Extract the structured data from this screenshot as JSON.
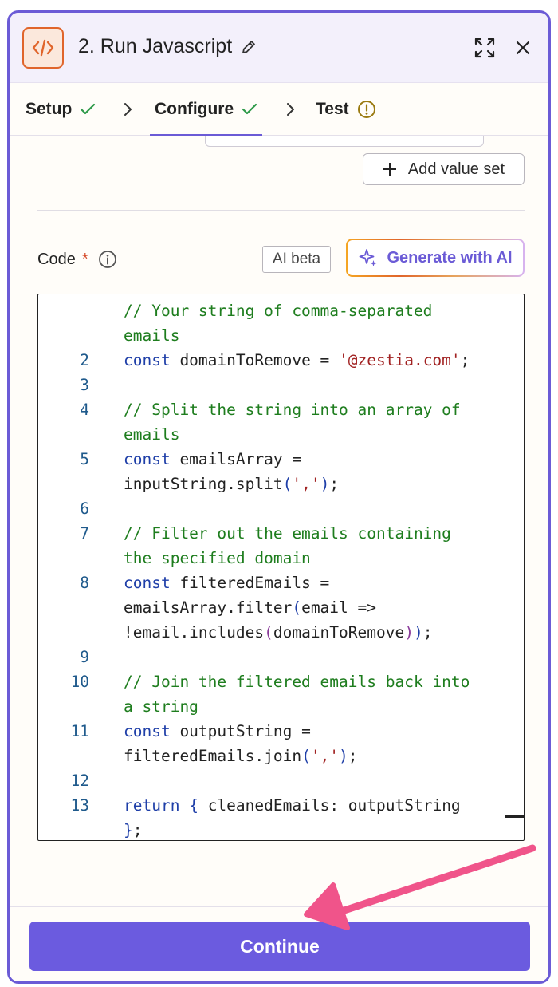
{
  "header": {
    "title": "2. Run Javascript",
    "icon": "code-icon",
    "accent": "#6b5bd6"
  },
  "tabs": [
    {
      "label": "Setup",
      "status": "complete"
    },
    {
      "label": "Configure",
      "status": "complete",
      "active": true
    },
    {
      "label": "Test",
      "status": "warning"
    }
  ],
  "config": {
    "add_value_set_label": "Add value set",
    "code_label": "Code",
    "required_mark": "*",
    "ai_badge": "AI beta",
    "generate_label": "Generate with AI"
  },
  "editor": {
    "lines": [
      {
        "num": "",
        "segments": [
          {
            "t": "// Your string of comma-separated",
            "k": "cm"
          }
        ]
      },
      {
        "num": "",
        "segments": [
          {
            "t": "emails",
            "k": "cm"
          }
        ]
      },
      {
        "num": "2",
        "segments": [
          {
            "t": "const",
            "k": "kw"
          },
          {
            "t": " domainToRemove = ",
            "k": "tx"
          },
          {
            "t": "'@zestia.com'",
            "k": "str"
          },
          {
            "t": ";",
            "k": "tx"
          }
        ]
      },
      {
        "num": "3",
        "segments": []
      },
      {
        "num": "4",
        "segments": [
          {
            "t": "// Split the string into an array of",
            "k": "cm"
          }
        ]
      },
      {
        "num": "",
        "segments": [
          {
            "t": "emails",
            "k": "cm"
          }
        ]
      },
      {
        "num": "5",
        "segments": [
          {
            "t": "const",
            "k": "kw"
          },
          {
            "t": " emailsArray =",
            "k": "tx"
          }
        ]
      },
      {
        "num": "",
        "segments": [
          {
            "t": "inputString.split",
            "k": "tx"
          },
          {
            "t": "(",
            "k": "pn"
          },
          {
            "t": "','",
            "k": "str"
          },
          {
            "t": ")",
            "k": "pn"
          },
          {
            "t": ";",
            "k": "tx"
          }
        ]
      },
      {
        "num": "6",
        "segments": []
      },
      {
        "num": "7",
        "segments": [
          {
            "t": "// Filter out the emails containing",
            "k": "cm"
          }
        ]
      },
      {
        "num": "",
        "segments": [
          {
            "t": "the specified domain",
            "k": "cm"
          }
        ]
      },
      {
        "num": "8",
        "segments": [
          {
            "t": "const",
            "k": "kw"
          },
          {
            "t": " filteredEmails =",
            "k": "tx"
          }
        ]
      },
      {
        "num": "",
        "segments": [
          {
            "t": "emailsArray.filter",
            "k": "tx"
          },
          {
            "t": "(",
            "k": "pn"
          },
          {
            "t": "email =>",
            "k": "tx"
          }
        ]
      },
      {
        "num": "",
        "segments": [
          {
            "t": "!email.includes",
            "k": "tx"
          },
          {
            "t": "(",
            "k": "pn2"
          },
          {
            "t": "domainToRemove",
            "k": "tx"
          },
          {
            "t": ")",
            "k": "pn2"
          },
          {
            "t": ")",
            "k": "pn"
          },
          {
            "t": ";",
            "k": "tx"
          }
        ]
      },
      {
        "num": "9",
        "segments": []
      },
      {
        "num": "10",
        "segments": [
          {
            "t": "// Join the filtered emails back into",
            "k": "cm"
          }
        ]
      },
      {
        "num": "",
        "segments": [
          {
            "t": "a string",
            "k": "cm"
          }
        ]
      },
      {
        "num": "11",
        "segments": [
          {
            "t": "const",
            "k": "kw"
          },
          {
            "t": " outputString =",
            "k": "tx"
          }
        ]
      },
      {
        "num": "",
        "segments": [
          {
            "t": "filteredEmails.join",
            "k": "tx"
          },
          {
            "t": "(",
            "k": "pn"
          },
          {
            "t": "','",
            "k": "str"
          },
          {
            "t": ")",
            "k": "pn"
          },
          {
            "t": ";",
            "k": "tx"
          }
        ]
      },
      {
        "num": "12",
        "segments": []
      },
      {
        "num": "13",
        "segments": [
          {
            "t": "return",
            "k": "kw"
          },
          {
            "t": " ",
            "k": "tx"
          },
          {
            "t": "{",
            "k": "pn"
          },
          {
            "t": " cleanedEmails: outputString",
            "k": "tx"
          }
        ]
      },
      {
        "num": "",
        "segments": [
          {
            "t": "}",
            "k": "pn"
          },
          {
            "t": ";",
            "k": "tx"
          }
        ]
      }
    ]
  },
  "footer": {
    "continue_label": "Continue"
  }
}
